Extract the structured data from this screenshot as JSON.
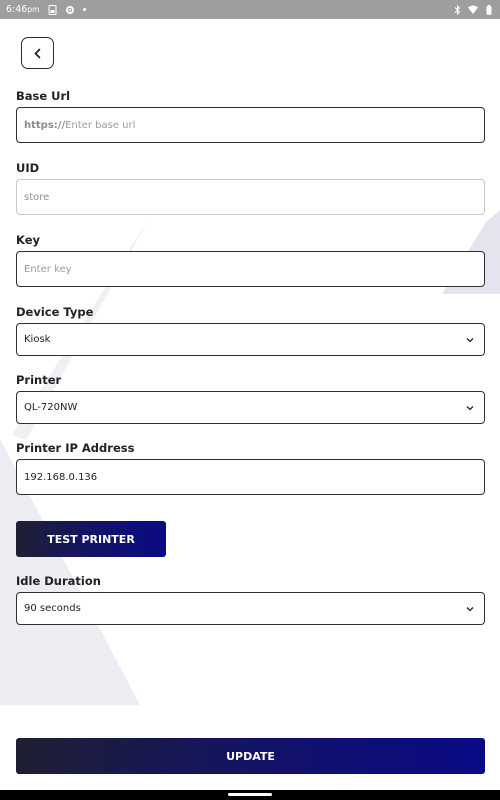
{
  "status_bar": {
    "time": "6:46",
    "ampm": "pm"
  },
  "back_button": {
    "icon": "chevron-left-icon"
  },
  "form": {
    "base_url": {
      "label": "Base Url",
      "prefix": "https://",
      "placeholder": "Enter base url"
    },
    "uid": {
      "label": "UID",
      "value": "store"
    },
    "key": {
      "label": "Key",
      "placeholder": "Enter key"
    },
    "device_type": {
      "label": "Device Type",
      "selected": "Kiosk"
    },
    "printer": {
      "label": "Printer",
      "selected": "QL-720NW"
    },
    "printer_ip": {
      "label": "Printer IP Address",
      "value": "192.168.0.136"
    },
    "test_printer_label": "TEST PRINTER",
    "idle_duration": {
      "label": "Idle Duration",
      "selected": "90 seconds"
    }
  },
  "update_label": "UPDATE",
  "colors": {
    "button_gradient_start": "#1f1f33",
    "button_gradient_end": "#0a0a86",
    "status_bar": "#9e9e9e",
    "deco": "#ececf3"
  }
}
